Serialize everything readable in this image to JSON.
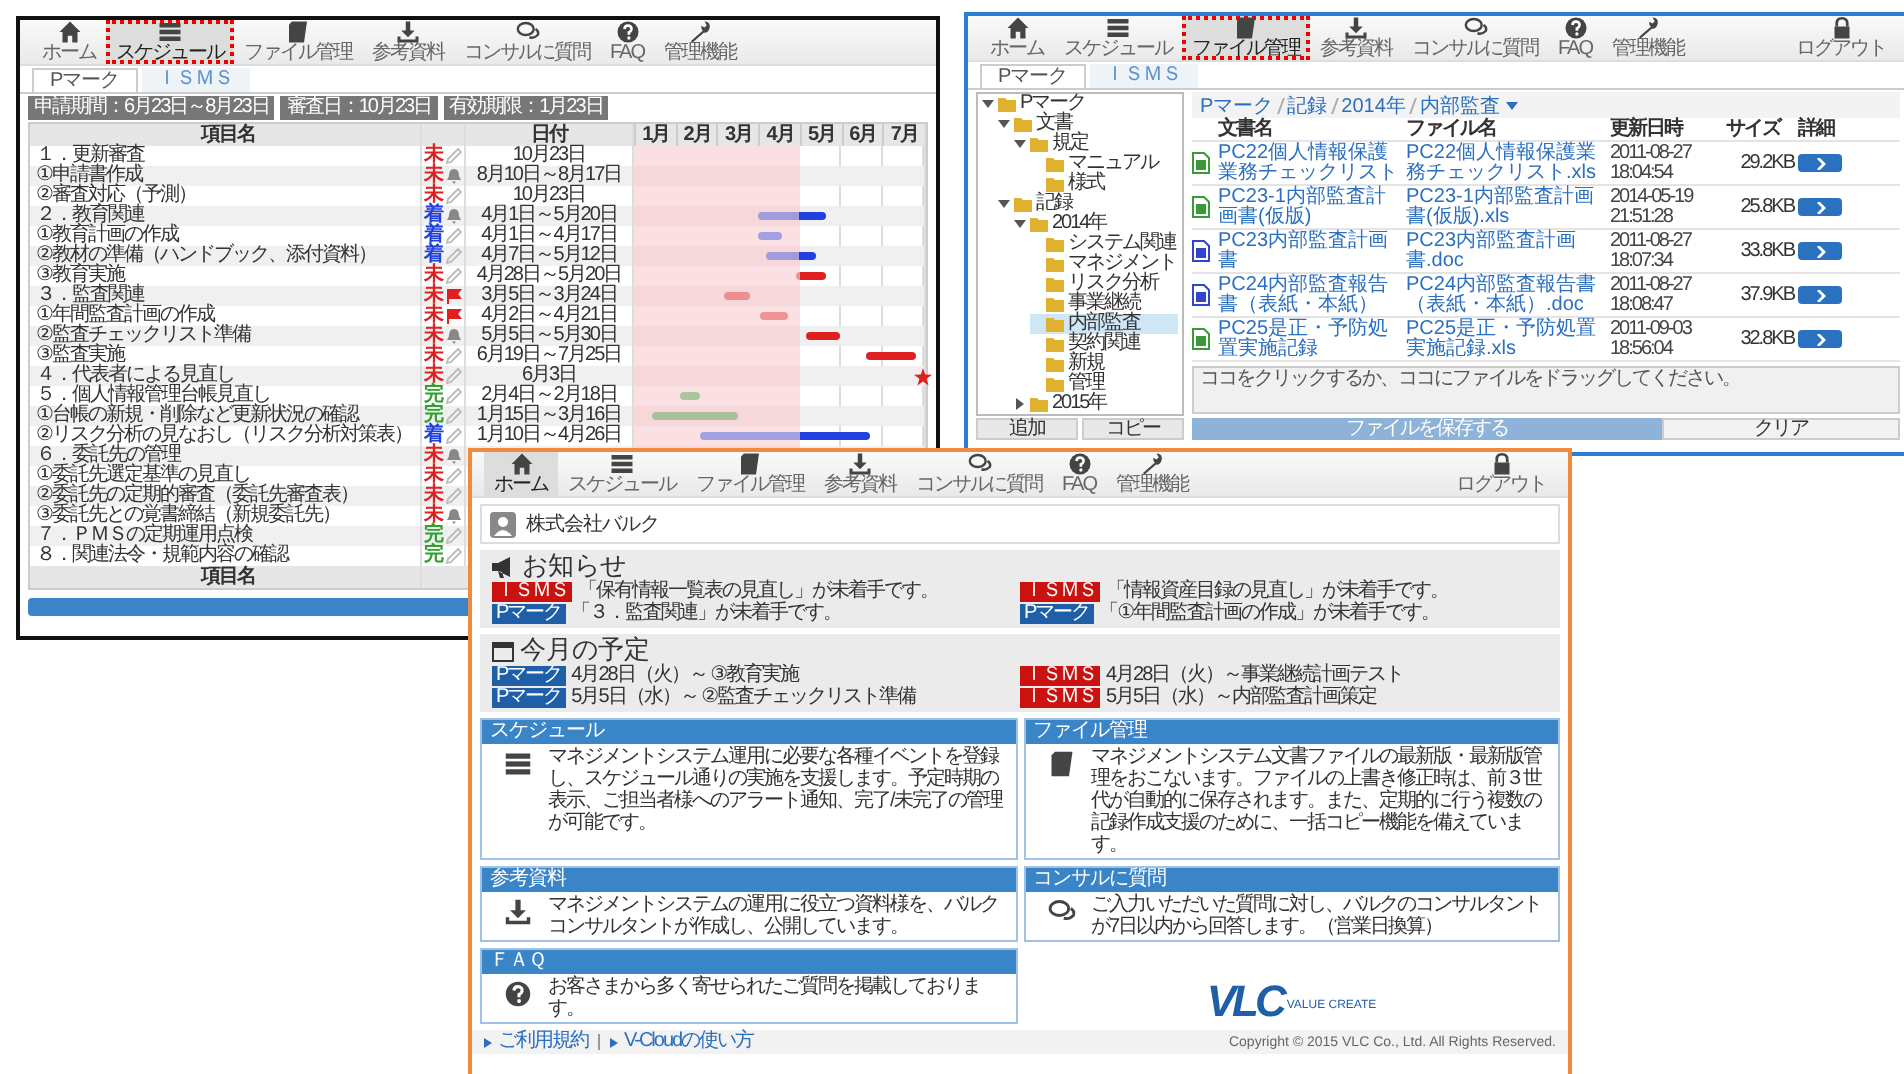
{
  "schedule_window": {
    "callout": true,
    "nav": [
      {
        "kind": "home",
        "label": "ホーム",
        "selected": false
      },
      {
        "kind": "schedule",
        "label": "スケジュール",
        "selected": true
      },
      {
        "kind": "files",
        "label": "ファイル管理",
        "selected": false
      },
      {
        "kind": "downloads",
        "label": "参考資料",
        "selected": false
      },
      {
        "kind": "questions",
        "label": "コンサルに質問",
        "selected": false
      },
      {
        "kind": "faq",
        "label": "FAQ",
        "selected": false
      },
      {
        "kind": "admin",
        "label": "管理機能",
        "selected": false
      }
    ],
    "tabs": [
      {
        "label": "Pマーク",
        "selected": true
      },
      {
        "label": "ＩＳＭＳ",
        "selected": false
      }
    ],
    "chips": [
      "申請期間：6月23日～8月23日",
      "審査日：10月23日",
      "有効期限：1月23日"
    ],
    "columns": [
      "項目名",
      "日付"
    ],
    "months": [
      "1月",
      "2月",
      "3月",
      "4月",
      "5月",
      "6月",
      "7月"
    ],
    "rows": [
      {
        "name": "１．更新審査",
        "status": "未",
        "color": "#e02020",
        "kind": "pen",
        "date": "10月23日"
      },
      {
        "name": "①申請書作成",
        "status": "未",
        "color": "#e02020",
        "kind": "bell",
        "date": "8月10日～8月17日"
      },
      {
        "name": "②審査対応（予測）",
        "status": "未",
        "color": "#e02020",
        "kind": "pen",
        "date": "10月23日"
      },
      {
        "name": "２．教育関連",
        "status": "着",
        "color": "#2040e0",
        "kind": "bell",
        "date": "4月1日～5月20日"
      },
      {
        "name": "①教育計画の作成",
        "status": "着",
        "color": "#2040e0",
        "kind": "pen",
        "date": "4月1日～4月17日"
      },
      {
        "name": "②教材の準備（ハンドブック、添付資料）",
        "status": "着",
        "color": "#2040e0",
        "kind": "pen",
        "date": "4月7日～5月12日"
      },
      {
        "name": "③教育実施",
        "status": "未",
        "color": "#e02020",
        "kind": "pen",
        "date": "4月28日～5月20日"
      },
      {
        "name": "３．監査関連",
        "status": "未",
        "color": "#e02020",
        "kind": "alert",
        "date": "3月5日～3月24日"
      },
      {
        "name": "①年間監査計画の作成",
        "status": "未",
        "color": "#e02020",
        "kind": "alert",
        "date": "4月2日～4月21日"
      },
      {
        "name": "②監査チェックリスト準備",
        "status": "未",
        "color": "#e02020",
        "kind": "bell",
        "date": "5月5日～5月30日"
      },
      {
        "name": "③監査実施",
        "status": "未",
        "color": "#e02020",
        "kind": "pen",
        "date": "6月19日～7月25日"
      },
      {
        "name": "４．代表者による見直し",
        "status": "未",
        "color": "#e02020",
        "kind": "pen",
        "date": "6月3日"
      },
      {
        "name": "５．個人情報管理台帳見直し",
        "status": "完",
        "color": "#30a030",
        "kind": "pen",
        "date": "2月4日～2月18日"
      },
      {
        "name": "①台帳の新規・削除など更新状況の確認",
        "status": "完",
        "color": "#30a030",
        "kind": "pen",
        "date": "1月15日～3月16日"
      },
      {
        "name": "②リスク分析の見なおし（リスク分析対策表）",
        "status": "着",
        "color": "#2040e0",
        "kind": "pen",
        "date": "1月10日～4月26日"
      },
      {
        "name": "６．委託先の管理",
        "status": "未",
        "color": "#e02020",
        "kind": "bell"
      },
      {
        "name": "①委託先選定基準の見直し",
        "status": "未",
        "color": "#e02020",
        "kind": "pen"
      },
      {
        "name": "②委託先の定期的審査（委託先審査表）",
        "status": "未",
        "color": "#e02020",
        "kind": "pen"
      },
      {
        "name": "③委託先との覚書締結（新規委託先）",
        "status": "未",
        "color": "#e02020",
        "kind": "bell"
      },
      {
        "name": "７．ＰＭＳの定期運用点検",
        "status": "完",
        "color": "#30a030",
        "kind": "pen"
      },
      {
        "name": "８．関連法令・規範内容の確認",
        "status": "完",
        "color": "#30a030",
        "kind": "pen"
      }
    ],
    "footer": "項目名"
  },
  "file_window": {
    "callout": true,
    "nav": [
      {
        "kind": "home",
        "label": "ホーム",
        "selected": false
      },
      {
        "kind": "schedule",
        "label": "スケジュール",
        "selected": false
      },
      {
        "kind": "files",
        "label": "ファイル管理",
        "selected": true
      },
      {
        "kind": "downloads",
        "label": "参考資料",
        "selected": false
      },
      {
        "kind": "questions",
        "label": "コンサルに質問",
        "selected": false
      },
      {
        "kind": "faq",
        "label": "FAQ",
        "selected": false
      },
      {
        "kind": "admin",
        "label": "管理機能",
        "selected": false
      },
      {
        "kind": "logout",
        "label": "ログアウト",
        "selected": false
      }
    ],
    "tabs": [
      {
        "label": "Pマーク",
        "selected": true
      },
      {
        "label": "ＩＳＭＳ",
        "selected": false
      }
    ],
    "tree": [
      {
        "label": "Pマーク",
        "expanded": true,
        "selected": false,
        "children": [
          {
            "label": "文書",
            "expanded": true,
            "selected": false,
            "children": [
              {
                "label": "規定",
                "expanded": true,
                "selected": false,
                "children": [
                  {
                    "label": "マニュアル",
                    "selected": false
                  },
                  {
                    "label": "様式",
                    "selected": false
                  }
                ]
              }
            ]
          },
          {
            "label": "記録",
            "expanded": true,
            "selected": false,
            "children": [
              {
                "label": "2014年",
                "expanded": true,
                "selected": false,
                "children": [
                  {
                    "label": "システム関連",
                    "selected": false
                  },
                  {
                    "label": "マネジメント",
                    "selected": false
                  },
                  {
                    "label": "リスク分析",
                    "selected": false
                  },
                  {
                    "label": "事業継続",
                    "selected": false
                  },
                  {
                    "label": "内部監査",
                    "selected": true
                  },
                  {
                    "label": "契約関連",
                    "selected": false
                  },
                  {
                    "label": "新規",
                    "selected": false
                  },
                  {
                    "label": "管理",
                    "selected": false
                  }
                ]
              },
              {
                "label": "2015年",
                "expanded": false,
                "selected": false
              }
            ]
          }
        ]
      }
    ],
    "tree_buttons": [
      "追加",
      "コピー"
    ],
    "breadcrumb": [
      "Pマーク",
      "記録",
      "2014年",
      "内部監査"
    ],
    "columns": [
      "文書名",
      "ファイル名",
      "更新日時",
      "サイズ",
      "詳細"
    ],
    "files": [
      {
        "kind": "xls",
        "title": "PC22個人情報保護業務チェックリスト",
        "file": "PC22個人情報保護業務チェックリスト.xls",
        "updated": "2011-08-27 18:04:54",
        "size": "29.2KB"
      },
      {
        "kind": "xls",
        "title": "PC23-1内部監査計画書(仮版)",
        "file": "PC23-1内部監査計画書(仮版).xls",
        "updated": "2014-05-19 21:51:28",
        "size": "25.8KB"
      },
      {
        "kind": "doc",
        "title": "PC23内部監査計画書",
        "file": "PC23内部監査計画書.doc",
        "updated": "2011-08-27 18:07:34",
        "size": "33.8KB"
      },
      {
        "kind": "doc",
        "title": "PC24内部監査報告書（表紙・本紙）",
        "file": "PC24内部監査報告書（表紙・本紙）.doc",
        "updated": "2011-08-27 18:08:47",
        "size": "37.9KB"
      },
      {
        "kind": "xls",
        "title": "PC25是正・予防処置実施記録",
        "file": "PC25是正・予防処置実施記録.xls",
        "updated": "2011-09-03 18:56:04",
        "size": "32.8KB"
      }
    ],
    "drop_hint": "ココをクリックするか、ココにファイルをドラッグしてください。",
    "buttons": [
      "ファイルを保存する",
      "クリア"
    ]
  },
  "home_window": {
    "callout": false,
    "nav": [
      {
        "kind": "home",
        "label": "ホーム",
        "selected": true
      },
      {
        "kind": "schedule",
        "label": "スケジュール",
        "selected": false
      },
      {
        "kind": "files",
        "label": "ファイル管理",
        "selected": false
      },
      {
        "kind": "downloads",
        "label": "参考資料",
        "selected": false
      },
      {
        "kind": "questions",
        "label": "コンサルに質問",
        "selected": false
      },
      {
        "kind": "faq",
        "label": "FAQ",
        "selected": false
      },
      {
        "kind": "admin",
        "label": "管理機能",
        "selected": false
      },
      {
        "kind": "logout",
        "label": "ログアウト",
        "selected": false
      }
    ],
    "company": "株式会社バルク",
    "notices": {
      "title": "お知らせ",
      "items": [
        {
          "tag": "ＩＳＭＳ",
          "color": "#cc1111",
          "text": "「保有情報一覧表の見直し」が未着手です。"
        },
        {
          "tag": "ＩＳＭＳ",
          "color": "#cc1111",
          "text": "「情報資産目録の見直し」が未着手です。"
        },
        {
          "tag": "Pマーク",
          "color": "#1f5fa8",
          "text": "「３．監査関連」が未着手です。"
        },
        {
          "tag": "Pマーク",
          "color": "#1f5fa8",
          "text": "「①年間監査計画の作成」が未着手です。"
        }
      ]
    },
    "plans": {
      "title": "今月の予定",
      "items": [
        {
          "tag": "Pマーク",
          "color": "#1f5fa8",
          "text": "4月28日（火）～ ③教育実施"
        },
        {
          "tag": "ＩＳＭＳ",
          "color": "#cc1111",
          "text": "4月28日（火）～事業継続計画テスト"
        },
        {
          "tag": "Pマーク",
          "color": "#1f5fa8",
          "text": "5月5日（水）～ ②監査チェックリスト準備"
        },
        {
          "tag": "ＩＳＭＳ",
          "color": "#cc1111",
          "text": "5月5日（水）～内部監査計画策定"
        }
      ]
    },
    "cards": [
      {
        "kind": "schedule",
        "title": "スケジュール",
        "text": "マネジメントシステム運用に必要な各種イベントを登録し、スケジュール通りの実施を支援します。予定時期の表示、ご担当者様へのアラート通知、完了/未完了の管理が可能です。"
      },
      {
        "kind": "files",
        "title": "ファイル管理",
        "text": "マネジメントシステム文書ファイルの最新版・最新版管理をおこないます。ファイルの上書き修正時は、前３世代が自動的に保存されます。また、定期的に行う複数の記録作成支援のために、一括コピー機能を備えています。"
      },
      {
        "kind": "downloads",
        "title": "参考資料",
        "text": "マネジメントシステムの運用に役立つ資料様を、バルクコンサルタントが作成し、公開しています。"
      },
      {
        "kind": "questions",
        "title": "コンサルに質問",
        "text": "ご入力いただいた質問に対し、バルクのコンサルタントが7日以内から回答します。（営業日換算）"
      },
      {
        "kind": "faq",
        "title": "ＦＡＱ",
        "text": "お客さまから多く寄せられたご質問を掲載しております。"
      }
    ],
    "logo": {
      "mark": "VLC",
      "tagline": "VALUE CREATE"
    },
    "footer_links": [
      "ご利用規約",
      "V-Cloudの使い方"
    ],
    "copyright": "Copyright © 2015 VLC Co., Ltd. All Rights Reserved."
  }
}
